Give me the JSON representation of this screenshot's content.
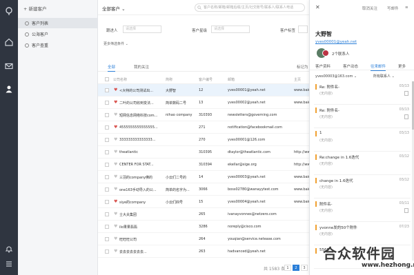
{
  "nav": {
    "new_customer": "+ 新建客户",
    "items": [
      {
        "label": "客户列表",
        "active": true
      },
      {
        "label": "公海客户",
        "active": false
      },
      {
        "label": "客户查重",
        "active": false
      }
    ]
  },
  "main": {
    "scope_label": "全部客户",
    "search_placeholder": "客户名称/邮箱/邮箱后缀/主页/社交账号/联系人/联系人电话",
    "filters": [
      {
        "label": "跟进人",
        "placeholder": "请选择"
      },
      {
        "label": "客户星级",
        "placeholder": "请选择"
      },
      {
        "label": "客户标签",
        "placeholder": ""
      }
    ],
    "more_filters": "更多筛选条件 ⌄",
    "tabs": [
      {
        "label": "全部",
        "active": true
      },
      {
        "label": "我的关注",
        "active": false
      }
    ],
    "tabs_right": "标记为",
    "columns": [
      "公司名称",
      "简称",
      "客户编号",
      "邮箱",
      "主页"
    ],
    "rows": [
      {
        "company": "<大特的公司测试出...",
        "short": "大野智",
        "code": "12",
        "email": "yves00001@yeah.net",
        "home": "www.baid",
        "heart": "red",
        "selected": true
      },
      {
        "company": "二叶的公司收到变法...",
        "short": "简单数码二号",
        "code": "13",
        "email": "yves00002@yeah.net",
        "home": "www.baid",
        "heart": "red",
        "selected": false
      },
      {
        "company": "短网信息网络科技com...",
        "short": "nihao company",
        "code": "310393",
        "email": "newsletters@governing.com",
        "home": "",
        "heart": "gray",
        "selected": false
      },
      {
        "company": "4555555555555555...",
        "short": "",
        "code": "271",
        "email": "notification@facebookmail.com",
        "home": "",
        "heart": "red",
        "selected": false
      },
      {
        "company": "333333333333333...",
        "short": "",
        "code": "270",
        "email": "yves00001@126.com",
        "home": "",
        "heart": "gray",
        "selected": false
      },
      {
        "company": "theatlantic",
        "short": "",
        "code": "310395",
        "email": "dtaylor@theatlantic.com",
        "home": "http://www",
        "heart": "gray",
        "selected": false
      },
      {
        "company": "CENTER FOR STAT...",
        "short": "",
        "code": "310394",
        "email": "ekellar@sige.org",
        "home": "http://www",
        "heart": "gray",
        "selected": false
      },
      {
        "company": "三羽的company佛的",
        "short": "小云们二号的",
        "code": "14",
        "email": "yves00003@yeah.net",
        "home": "www.baid",
        "heart": "gray",
        "selected": false
      },
      {
        "company": "one163手动导入的公...",
        "short": "简单的名字为...",
        "code": "3066",
        "email": "boss02780@wanayytest.com",
        "home": "www.baid",
        "heart": "gray",
        "selected": false
      },
      {
        "company": "siye的company",
        "short": "小云们四号",
        "code": "15",
        "email": "yves00004@yeah.net",
        "home": "www.baid",
        "heart": "red",
        "selected": false
      },
      {
        "company": "士大夫集团",
        "short": "",
        "code": "265",
        "email": "ivanayvonnes@netzero.com",
        "home": "",
        "heart": "gray",
        "selected": false
      },
      {
        "company": "ilo果果翡翡",
        "short": "",
        "code": "3286",
        "email": "noreply@cisco.com",
        "home": "",
        "heart": "gray",
        "selected": false
      },
      {
        "company": "旺旺旺公司",
        "short": "",
        "code": "264",
        "email": "youqian@service.netease.com",
        "home": "",
        "heart": "gray",
        "selected": false
      },
      {
        "company": "去去去去去去去...",
        "short": "",
        "code": "263",
        "email": "hadvanced@yeah.net",
        "home": "",
        "heart": "gray",
        "selected": false
      }
    ],
    "pager": {
      "total": "共 1583 条",
      "pages": [
        "1",
        "2",
        "3"
      ],
      "current": "2"
    }
  },
  "detail": {
    "actions": [
      "取消关注",
      "写邮件",
      "≡"
    ],
    "name": "大野智",
    "email": "yves00001@yeah.net",
    "contacts": "2个联系人",
    "tabs": [
      {
        "label": "客户资料",
        "active": false
      },
      {
        "label": "客户动态",
        "active": false
      },
      {
        "label": "往来邮件",
        "active": true
      },
      {
        "label": "更多",
        "active": false
      }
    ],
    "mailbox_select": "yves00003@163.com ⌄",
    "contact_select": "所有联系人 ⌄",
    "mails": [
      {
        "subject": "Re: 附件名-",
        "body": "(无内容)",
        "date": "03/13",
        "attach": true
      },
      {
        "subject": "Re: 附件名-",
        "body": "(无内容)",
        "date": "03/13",
        "attach": true
      },
      {
        "subject": "1",
        "body": "(无内容)",
        "date": "03/13",
        "attach": false
      },
      {
        "subject": "Re:change in 1.6迭代",
        "body": "(无内容)",
        "date": "03/12",
        "attach": false
      },
      {
        "subject": "change in 1.6迭代",
        "body": "(无内容)",
        "date": "03/12",
        "attach": false
      },
      {
        "subject": "附件名-",
        "body": "(无内容)",
        "date": "03/11",
        "attach": true
      },
      {
        "subject": "yvonne发的50个附件",
        "body": "(无内容)",
        "date": "07/23",
        "attach": false
      },
      {
        "subject": "5565",
        "body": "",
        "date": "",
        "attach": false
      }
    ]
  },
  "watermark": {
    "text": "合众软件园",
    "url": "www.hezhong.net"
  },
  "colors": {
    "accent": "#2b7fd8",
    "rail": "#2f3540",
    "heart_red": "#d9534f",
    "heart_gray": "#c4c4c4"
  },
  "icons": [
    "logo-icon",
    "home-icon",
    "mail-icon",
    "user-icon",
    "bell-icon",
    "menu-icon",
    "search-icon",
    "close-icon"
  ]
}
